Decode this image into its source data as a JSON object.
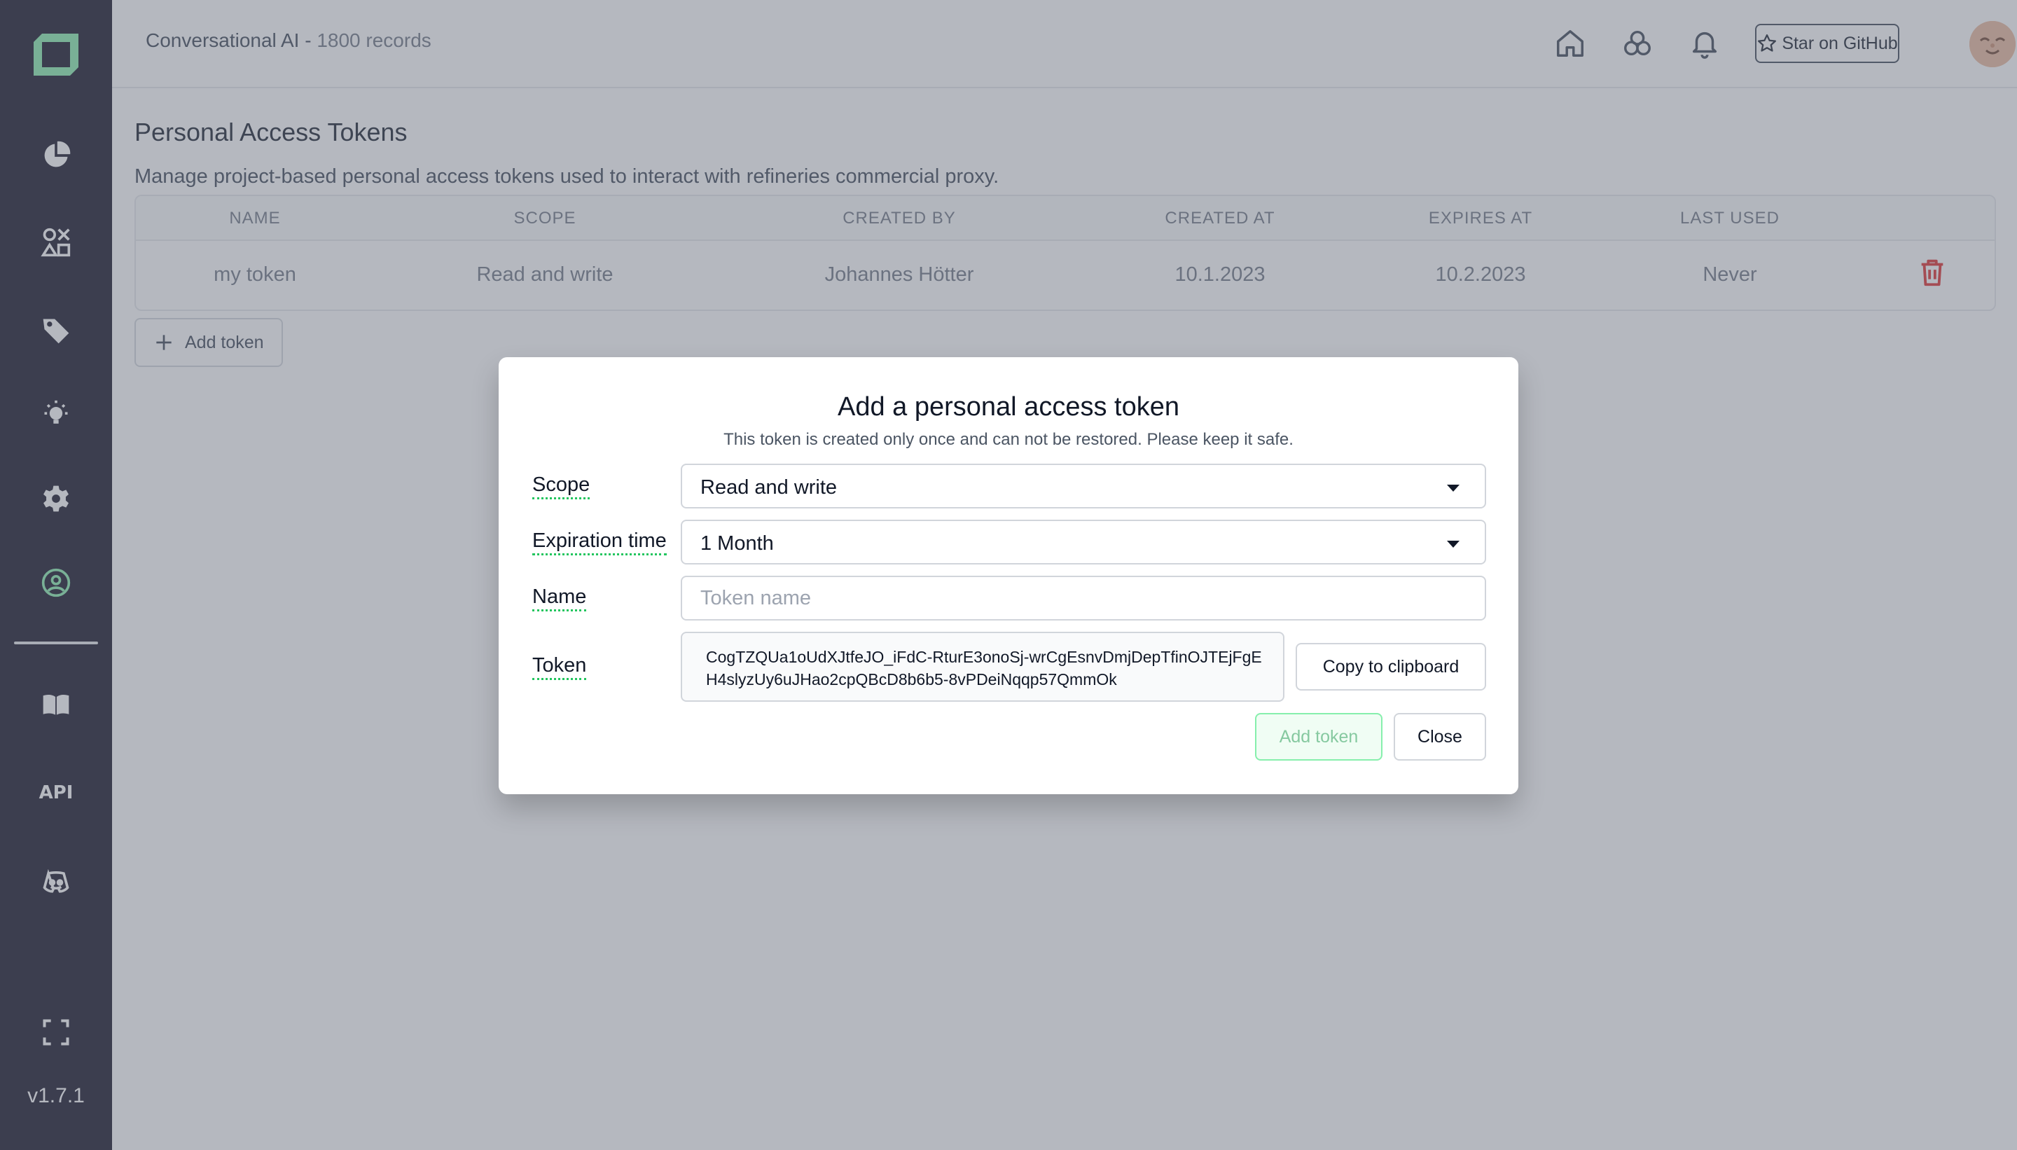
{
  "header": {
    "project_name": "Conversational AI - ",
    "record_count": "1800 records",
    "github_label": "Star on GitHub",
    "icons": [
      "home-icon",
      "models-icon",
      "bell-icon"
    ]
  },
  "sidebar": {
    "items": [
      "overview-icon",
      "data-browser-icon",
      "labeling-icon",
      "heuristics-icon",
      "settings-icon",
      "user-icon",
      "docs-icon",
      "api-icon",
      "discord-icon",
      "fullscreen-icon"
    ],
    "api_label": "API",
    "version": "v1.7.1"
  },
  "page": {
    "title": "Personal Access Tokens",
    "description": "Manage project-based personal access tokens used to interact with refineries commercial proxy.",
    "table": {
      "headers": [
        "NAME",
        "SCOPE",
        "CREATED BY",
        "CREATED AT",
        "EXPIRES AT",
        "LAST USED"
      ],
      "rows": [
        [
          "my token",
          "Read and write",
          "Johannes Hötter",
          "10.1.2023",
          "10.2.2023",
          "Never"
        ]
      ]
    },
    "add_token_label": "Add token"
  },
  "modal": {
    "title": "Add a personal access token",
    "subtitle": "This token is created only once and can not be restored. Please keep it safe.",
    "scope_label": "Scope",
    "scope_value": "Read and write",
    "expiration_label": "Expiration time",
    "expiration_value": "1 Month",
    "name_label": "Name",
    "name_placeholder": "Token name",
    "token_label": "Token",
    "token_value": "CogTZQUa1oUdXJtfeJO_iFdC-RturE3onoSj-wrCgEsnvDmjDepTfinOJTEjFgEH4slyzUy6uJHao2cpQBcD8b6b5-8vPDeiNqqp57QmmOk",
    "copy_label": "Copy to clipboard",
    "add_label": "Add token",
    "close_label": "Close"
  },
  "colors": {
    "sidebar_bg": "#0c0a1f",
    "accent_green": "#86efac",
    "danger_red": "#dc2626"
  }
}
